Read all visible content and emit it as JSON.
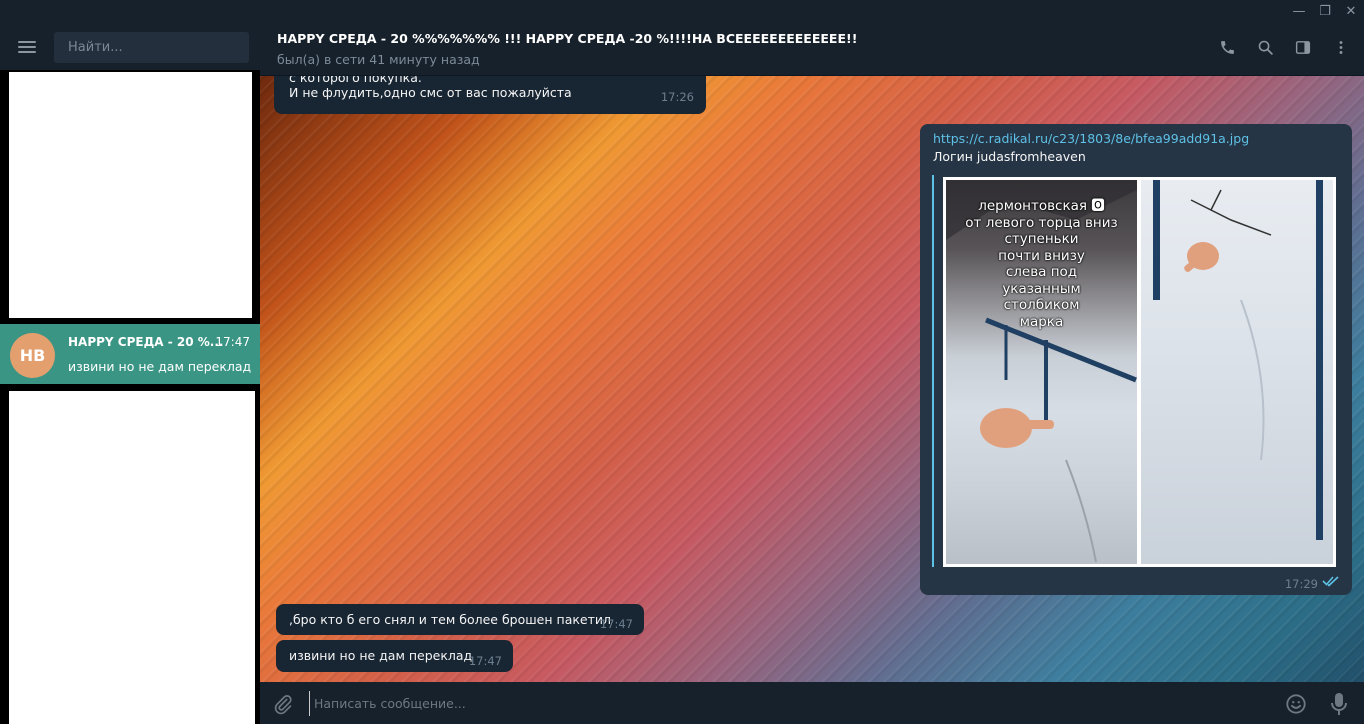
{
  "window": {
    "minimize_glyph": "—",
    "restore_glyph": "❐",
    "close_glyph": "✕"
  },
  "sidebar": {
    "search_placeholder": "Найти...",
    "chat": {
      "avatar_initials": "HB",
      "name": "HAPPY СРЕДА - 20 %...",
      "time": "17:47",
      "last_message": "извини но не дам переклад",
      "selected": true
    }
  },
  "header": {
    "title": "HAPPY СРЕДА - 20 %%%%%%% !!! HAPPY СРЕДА -20 %!!!!НА ВСЕЕЕЕЕЕЕЕЕЕЕЕЕ!!",
    "status": "был(а) в сети 41 минуту назад",
    "icons": [
      "phone-icon",
      "search-icon",
      "sidebar-toggle-icon",
      "more-vert-icon"
    ]
  },
  "messages": [
    {
      "direction": "in",
      "lines": [
        "с которого покупка.",
        "И не флудить,одно смс от вас пожалуйста"
      ],
      "time": "17:26"
    },
    {
      "direction": "out",
      "link": "https://c.radikal.ru/c23/1803/8e/bfea99add91a.jpg",
      "text": "Логин judasfromheaven",
      "photo_caption": "лермонтовская 🅾\nот левого торца вниз\nступеньки\nпочти внизу\nслева под\nуказанным\nстолбиком\nмарка",
      "time": "17:29",
      "read": true
    },
    {
      "direction": "in",
      "text": ",бро кто б его снял и тем более брошен пакетил",
      "time": "17:47"
    },
    {
      "direction": "in",
      "text": "извини но не дам переклад",
      "time": "17:47"
    }
  ],
  "compose": {
    "placeholder": "Написать сообщение..."
  },
  "colors": {
    "panel": "#17212b",
    "bubble_in": "#182533",
    "bubble_out": "#253546",
    "selected_chat": "#3a9584",
    "link": "#5ec1e6",
    "avatar": "#e39f6d"
  }
}
